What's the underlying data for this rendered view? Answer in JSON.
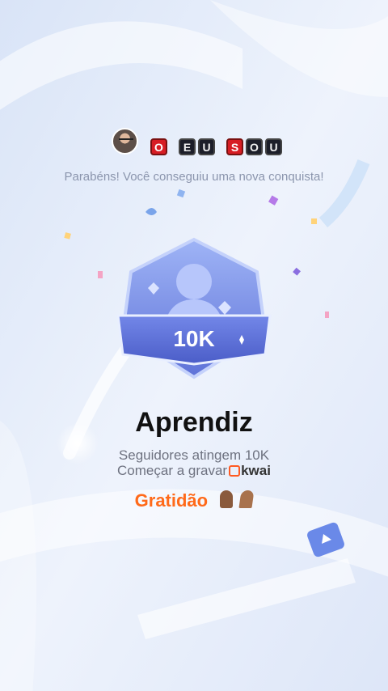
{
  "header": {
    "avatar_name": "user-avatar",
    "name_tiles": [
      {
        "letter": "O",
        "style": "red"
      },
      {
        "letter": "",
        "style": "empty"
      },
      {
        "letter": "E",
        "style": "dark"
      },
      {
        "letter": "U",
        "style": "dark"
      },
      {
        "letter": "",
        "style": "empty"
      },
      {
        "letter": "S",
        "style": "red"
      },
      {
        "letter": "O",
        "style": "dark"
      },
      {
        "letter": "U",
        "style": "dark"
      }
    ]
  },
  "subtitle": "Parabéns! Você conseguiu uma nova conquista!",
  "badge": {
    "label": "10K",
    "icon": "follower-badge-icon"
  },
  "achievement": {
    "title": "Aprendiz",
    "line1": "Seguidores atingem 10K",
    "line2_prefix": "Começar a gravar",
    "brand": "kwai"
  },
  "caption": "Gratidão",
  "colors": {
    "accent": "#ff6a1a",
    "badge": "#6b7fe0",
    "background": "#e6eefb"
  }
}
